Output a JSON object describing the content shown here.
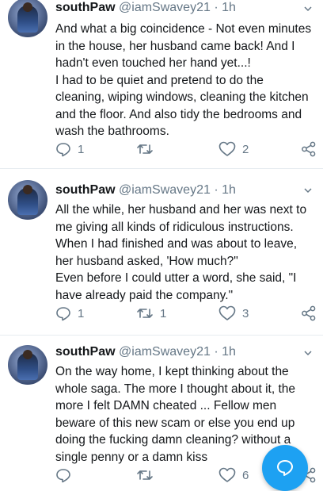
{
  "colors": {
    "accent": "#1da1f2",
    "secondary_text": "#657786"
  },
  "tweets": [
    {
      "name": "southPaw",
      "handle": "@iamSwavey21",
      "separator": "·",
      "time": "1h",
      "lines": [
        "And what a big coincidence - Not even minutes",
        "in the house, her husband came back! And I",
        "hadn't even touched her hand yet...!",
        "I had to be quiet and pretend to do the",
        "cleaning, wiping windows, cleaning the kitchen",
        "and the floor. And also tidy the bedrooms and",
        "wash the bathrooms."
      ],
      "replies": "1",
      "retweets": "",
      "likes": "2"
    },
    {
      "name": "southPaw",
      "handle": "@iamSwavey21",
      "separator": "·",
      "time": "1h",
      "lines": [
        "All the while, her husband and her was next to",
        "me giving all kinds of ridiculous instructions.",
        "When I had finished and was about to leave,",
        "her husband asked, 'How much?\"",
        "Even before I could utter a word, she said, \"I",
        "have already paid the company.\""
      ],
      "replies": "1",
      "retweets": "1",
      "likes": "3"
    },
    {
      "name": "southPaw",
      "handle": "@iamSwavey21",
      "separator": "·",
      "time": "1h",
      "lines": [
        "On the way home, I kept thinking about the",
        "whole saga. The more I thought about it, the",
        "more I felt DAMN cheated ... Fellow men",
        "beware of this new scam or else you end up",
        "doing the fucking damn cleaning? without a",
        "single penny or a damn kiss"
      ],
      "replies": "",
      "retweets": "",
      "likes": "6"
    }
  ],
  "icons": {
    "reply": "reply-icon",
    "retweet": "retweet-icon",
    "like": "heart-icon",
    "share": "share-icon",
    "menu": "chevron-down-icon",
    "compose": "compose-tweet-icon"
  }
}
